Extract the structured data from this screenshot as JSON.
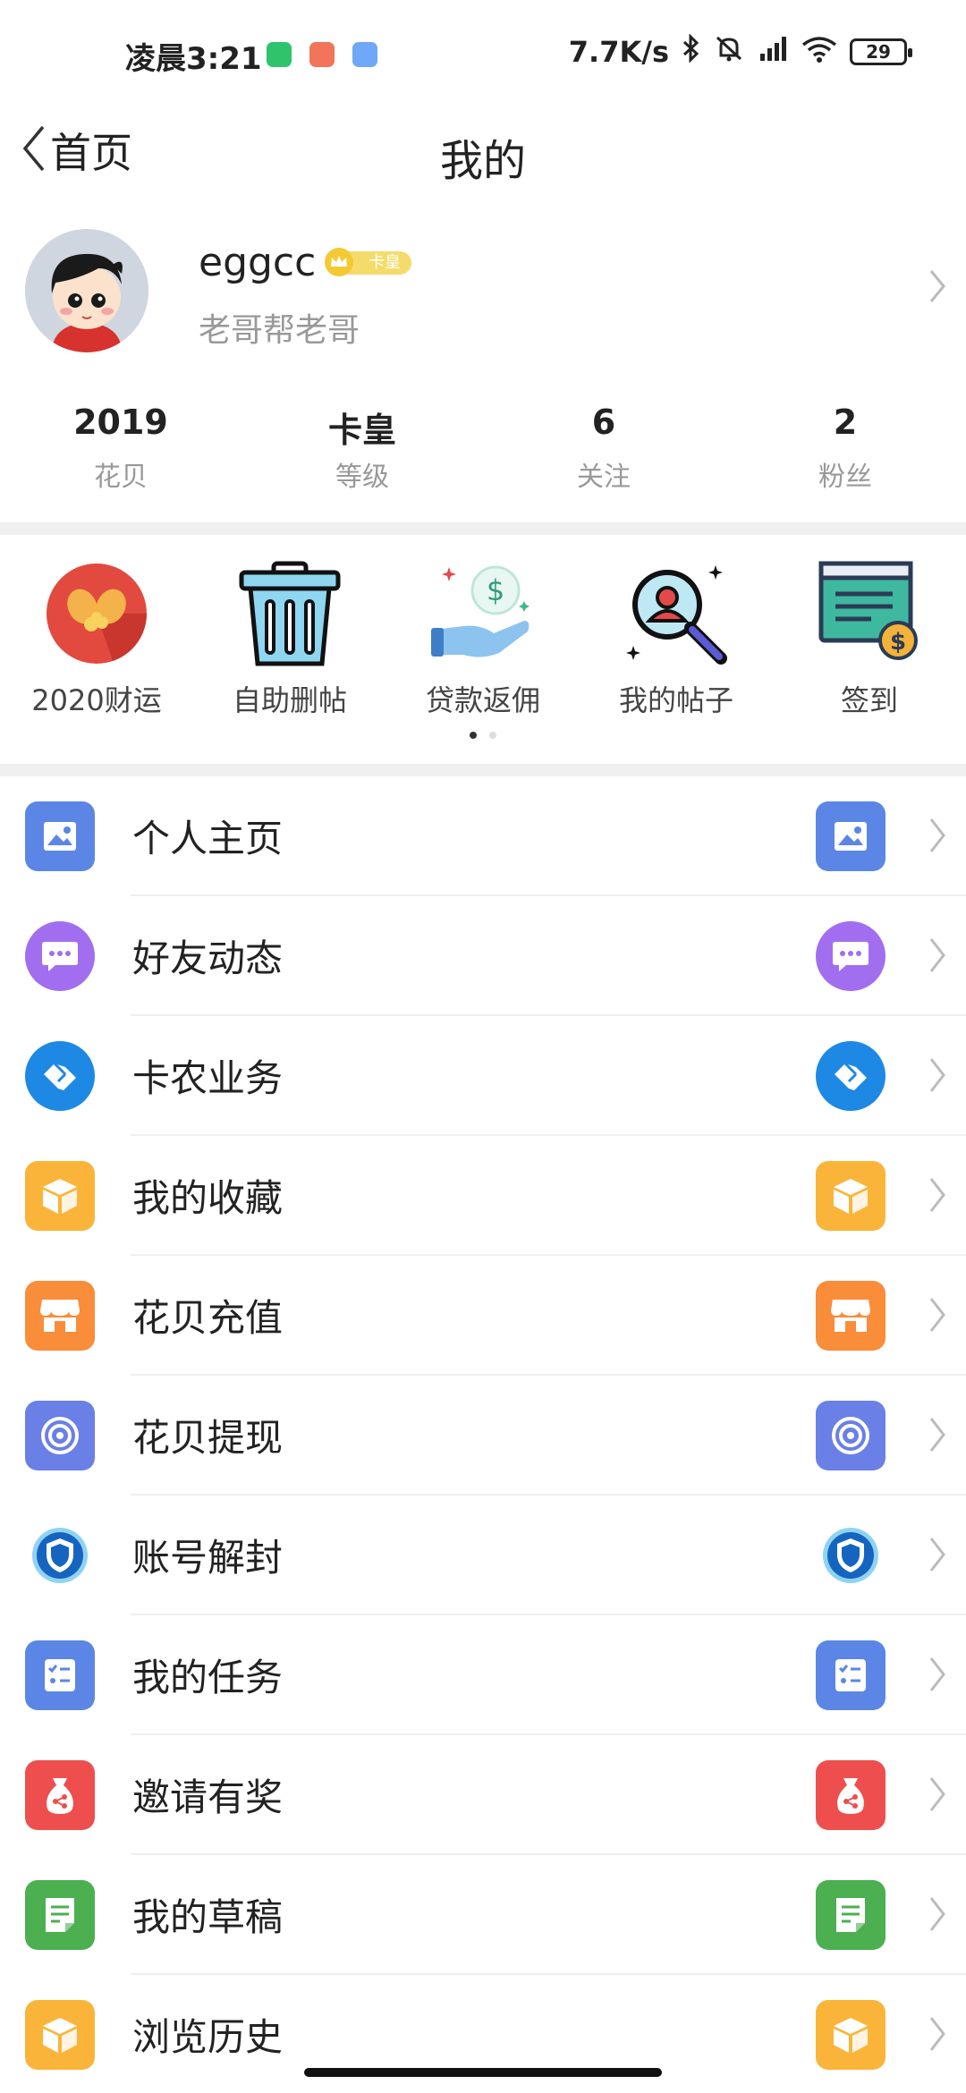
{
  "status_bar": {
    "time": "凌晨3:21",
    "net_speed": "7.7K/s",
    "battery": "29"
  },
  "nav": {
    "back_label": "首页",
    "title": "我的"
  },
  "profile": {
    "username": "eggcc",
    "level_badge": "卡皇",
    "signature": "老哥帮老哥"
  },
  "stats": [
    {
      "value": "2019",
      "label": "花贝"
    },
    {
      "value": "卡皇",
      "label": "等级"
    },
    {
      "value": "6",
      "label": "关注"
    },
    {
      "value": "2",
      "label": "粉丝"
    }
  ],
  "quick_actions": [
    {
      "label": "2020财运",
      "icon": "fortune-icon"
    },
    {
      "label": "自助删帖",
      "icon": "trash-icon"
    },
    {
      "label": "贷款返佣",
      "icon": "loan-rebate-icon"
    },
    {
      "label": "我的帖子",
      "icon": "my-posts-icon"
    },
    {
      "label": "签到",
      "icon": "checkin-icon"
    }
  ],
  "menu": [
    {
      "label": "个人主页",
      "icon": "image-icon",
      "color": "#5b86e5"
    },
    {
      "label": "好友动态",
      "icon": "chat-icon",
      "color": "#a26ef0"
    },
    {
      "label": "卡农业务",
      "icon": "handshake-icon",
      "color": "#1e88e5"
    },
    {
      "label": "我的收藏",
      "icon": "box-icon",
      "color": "#fbb43a"
    },
    {
      "label": "花贝充值",
      "icon": "shop-icon",
      "color": "#f98d3a"
    },
    {
      "label": "花贝提现",
      "icon": "swirl-icon",
      "color": "#6a80e6"
    },
    {
      "label": "账号解封",
      "icon": "shield-icon",
      "color": "#1565c0"
    },
    {
      "label": "我的任务",
      "icon": "task-icon",
      "color": "#5b86e5"
    },
    {
      "label": "邀请有奖",
      "icon": "gift-bag-icon",
      "color": "#ee4e4e"
    },
    {
      "label": "我的草稿",
      "icon": "draft-icon",
      "color": "#4caf50"
    },
    {
      "label": "浏览历史",
      "icon": "box-icon",
      "color": "#fbb43a"
    }
  ]
}
